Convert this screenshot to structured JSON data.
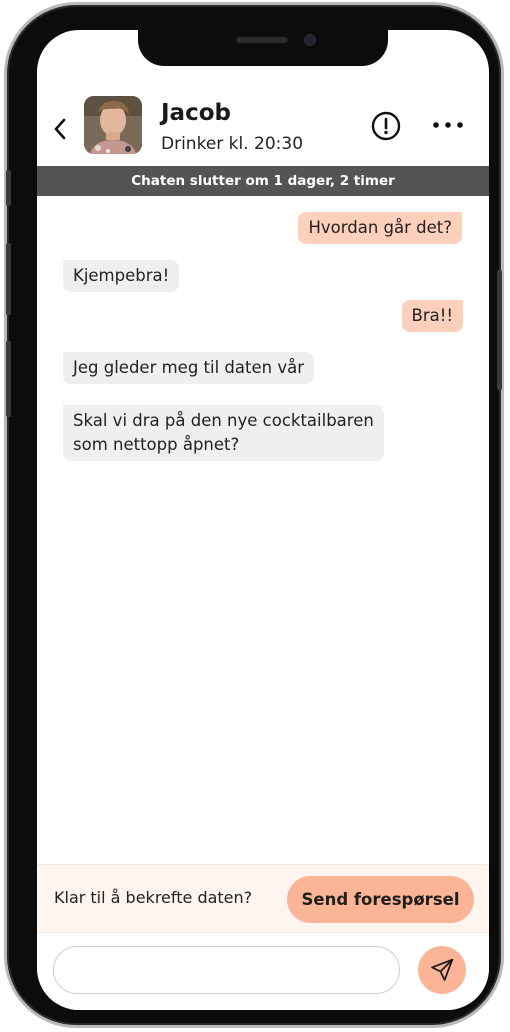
{
  "header": {
    "name": "Jacob",
    "subtitle": "Drinker kl. 20:30",
    "back_icon": "chevron-left-icon",
    "alert_icon": "alert-circle-icon",
    "more_icon": "more-horizontal-icon"
  },
  "banner": {
    "text": "Chaten slutter om 1 dager, 2 timer"
  },
  "messages": [
    {
      "from": "me",
      "line1": "Hvordan går det?"
    },
    {
      "from": "them",
      "line1": "Kjempebra!"
    },
    {
      "from": "me",
      "line1": "Bra!!"
    },
    {
      "from": "them",
      "line1": "Jeg gleder meg til daten vår"
    },
    {
      "from": "them",
      "line1": "Skal vi dra på den nye cocktailbaren",
      "line2": "som nettopp åpnet?"
    }
  ],
  "confirm": {
    "prompt": "Klar til å bekrefte daten?",
    "button": "Send forespørsel"
  },
  "composer": {
    "value": "",
    "placeholder": "",
    "send_icon": "send-icon"
  },
  "colors": {
    "accent": "#fbb596",
    "outgoing_bubble": "#fdd0bb",
    "incoming_bubble": "#efefef",
    "banner": "#545454",
    "confirm_bg": "#fff5f0"
  }
}
